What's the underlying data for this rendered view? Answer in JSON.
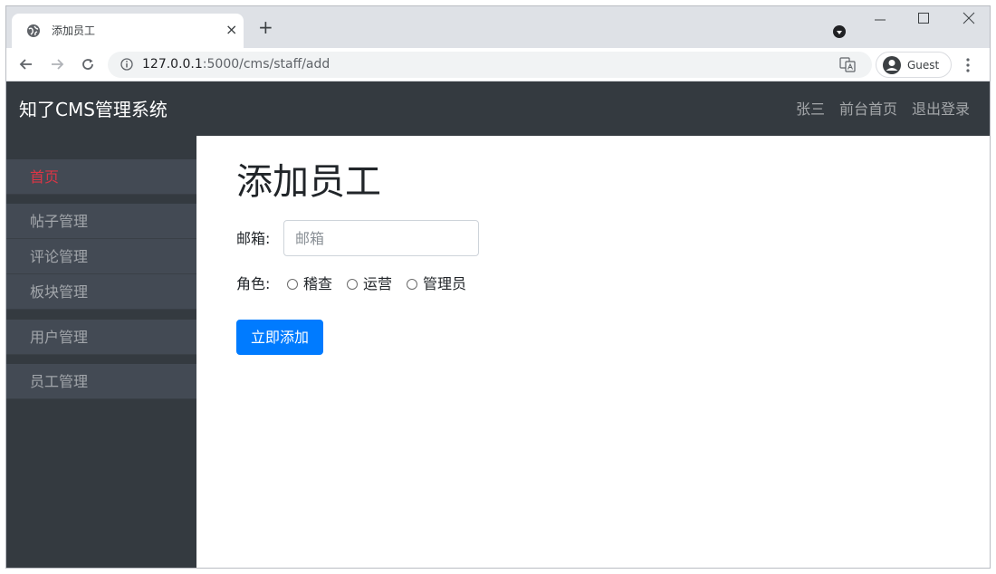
{
  "browser": {
    "tab_title": "添加员工",
    "tab_close": "×",
    "new_tab": "+",
    "url_host": "127.0.0.1",
    "url_path": ":5000/cms/staff/add",
    "profile_label": "Guest"
  },
  "app": {
    "brand": "知了CMS管理系统",
    "nav": {
      "user": "张三",
      "front_home": "前台首页",
      "logout": "退出登录"
    }
  },
  "sidebar": {
    "items": [
      {
        "label": "首页"
      },
      {
        "label": "帖子管理"
      },
      {
        "label": "评论管理"
      },
      {
        "label": "板块管理"
      },
      {
        "label": "用户管理"
      },
      {
        "label": "员工管理"
      }
    ]
  },
  "form": {
    "title": "添加员工",
    "email_label": "邮箱:",
    "email_placeholder": "邮箱",
    "email_value": "",
    "role_label": "角色:",
    "roles": [
      {
        "label": "稽查"
      },
      {
        "label": "运营"
      },
      {
        "label": "管理员"
      }
    ],
    "submit_label": "立即添加"
  },
  "colors": {
    "navbar_bg": "#343a40",
    "sidebar_item_bg": "#434a54",
    "active_item": "#dc3545",
    "primary_button": "#007bff"
  }
}
